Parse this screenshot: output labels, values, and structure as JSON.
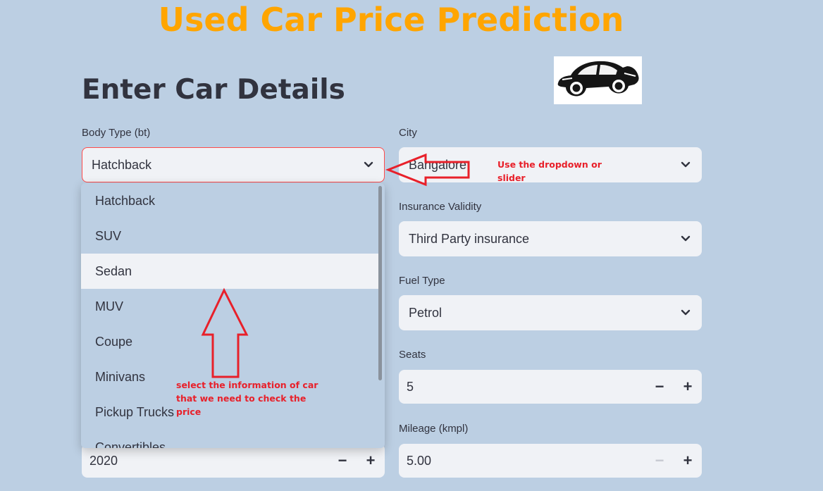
{
  "app": {
    "title": "Used Car Price Prediction"
  },
  "section": {
    "title": "Enter Car Details"
  },
  "colors": {
    "accent_title": "#ffa500",
    "background": "#bccfe3",
    "input_bg": "#f0f2f6",
    "focus_border": "#ff4b4b",
    "annotation_red": "#e8202a"
  },
  "logo": {
    "icon": "vintage-car-icon"
  },
  "fields": {
    "body_type": {
      "label": "Body Type (bt)",
      "value": "Hatchback"
    },
    "city": {
      "label": "City",
      "value": "Bangalore"
    },
    "insurance": {
      "label": "Insurance Validity",
      "value": "Third Party insurance"
    },
    "fuel": {
      "label": "Fuel Type",
      "value": "Petrol"
    },
    "seats": {
      "label": "Seats",
      "value": "5"
    },
    "mileage": {
      "label": "Mileage (kmpl)",
      "value": "5.00"
    },
    "year": {
      "value": "2020"
    }
  },
  "stepper": {
    "minus": "−",
    "plus": "+"
  },
  "dropdown": {
    "options": [
      "Hatchback",
      "SUV",
      "Sedan",
      "MUV",
      "Coupe",
      "Minivans",
      "Pickup Trucks",
      "Convertibles"
    ],
    "highlighted": "Sedan"
  },
  "annotations": {
    "dropdown_hint_line1": "Use the dropdown or",
    "dropdown_hint_line2": "slider",
    "select_hint_line1": "select the information of car",
    "select_hint_line2": "that we need to check the",
    "select_hint_line3": "price"
  }
}
